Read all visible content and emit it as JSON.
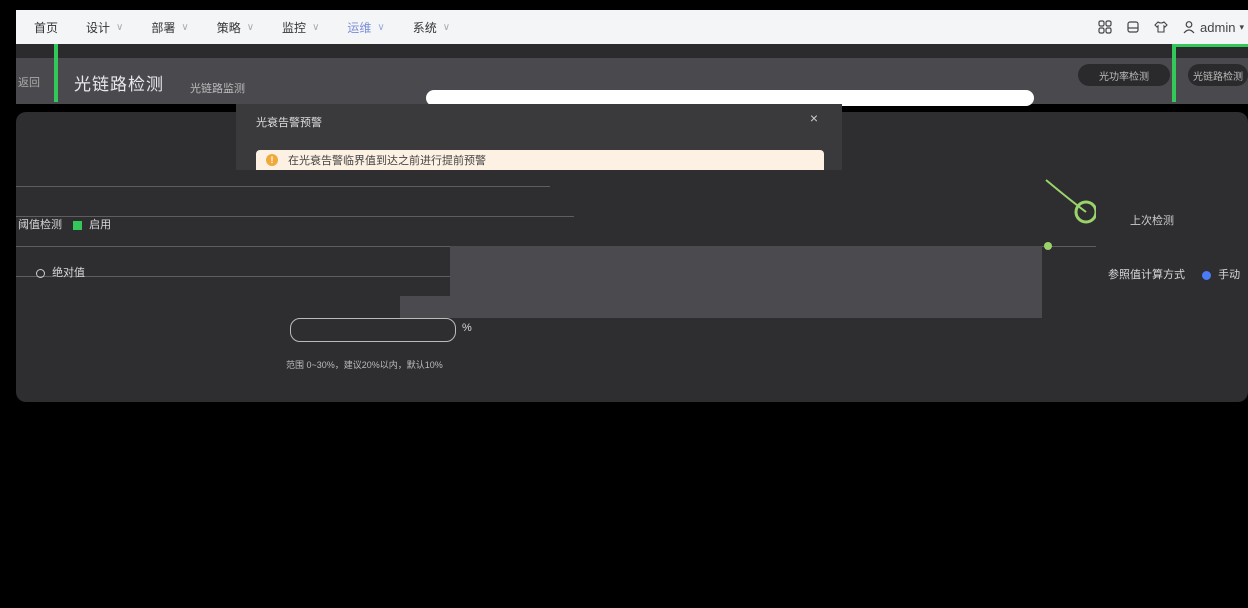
{
  "nav": {
    "items": [
      {
        "label": "首页",
        "dropdown": false,
        "active": false
      },
      {
        "label": "设计",
        "dropdown": true,
        "active": false
      },
      {
        "label": "部署",
        "dropdown": true,
        "active": false
      },
      {
        "label": "策略",
        "dropdown": true,
        "active": false
      },
      {
        "label": "监控",
        "dropdown": true,
        "active": false
      },
      {
        "label": "运维",
        "dropdown": true,
        "active": true
      },
      {
        "label": "系统",
        "dropdown": true,
        "active": false
      }
    ],
    "user": "admin",
    "icons": [
      "apps-icon",
      "save-icon",
      "shirt-icon",
      "user-icon"
    ]
  },
  "page": {
    "back": "返回",
    "title": "光链路检测",
    "subtitle": "光链路监测",
    "btn_left": "光功率检测",
    "btn_right": "光链路检测"
  },
  "panel": {
    "check_label": "阈值检测",
    "enable_label": "启用",
    "threshold_label": "绝对值",
    "unit": "%",
    "hint": "范围 0~30%，建议20%以内，默认10%",
    "calc_label": "参照值计算方式",
    "calc_option": "手动",
    "last_check": "上次检测"
  },
  "dialog": {
    "title": "光衰告警预警",
    "close": "×",
    "alert_text": "在光衰告警临界值到达之前进行提前预警"
  },
  "colors": {
    "accent_green": "#34c759",
    "active_nav": "#7c8fd6",
    "warning": "#f0a93b",
    "alert_bg": "#fdf1e3"
  }
}
